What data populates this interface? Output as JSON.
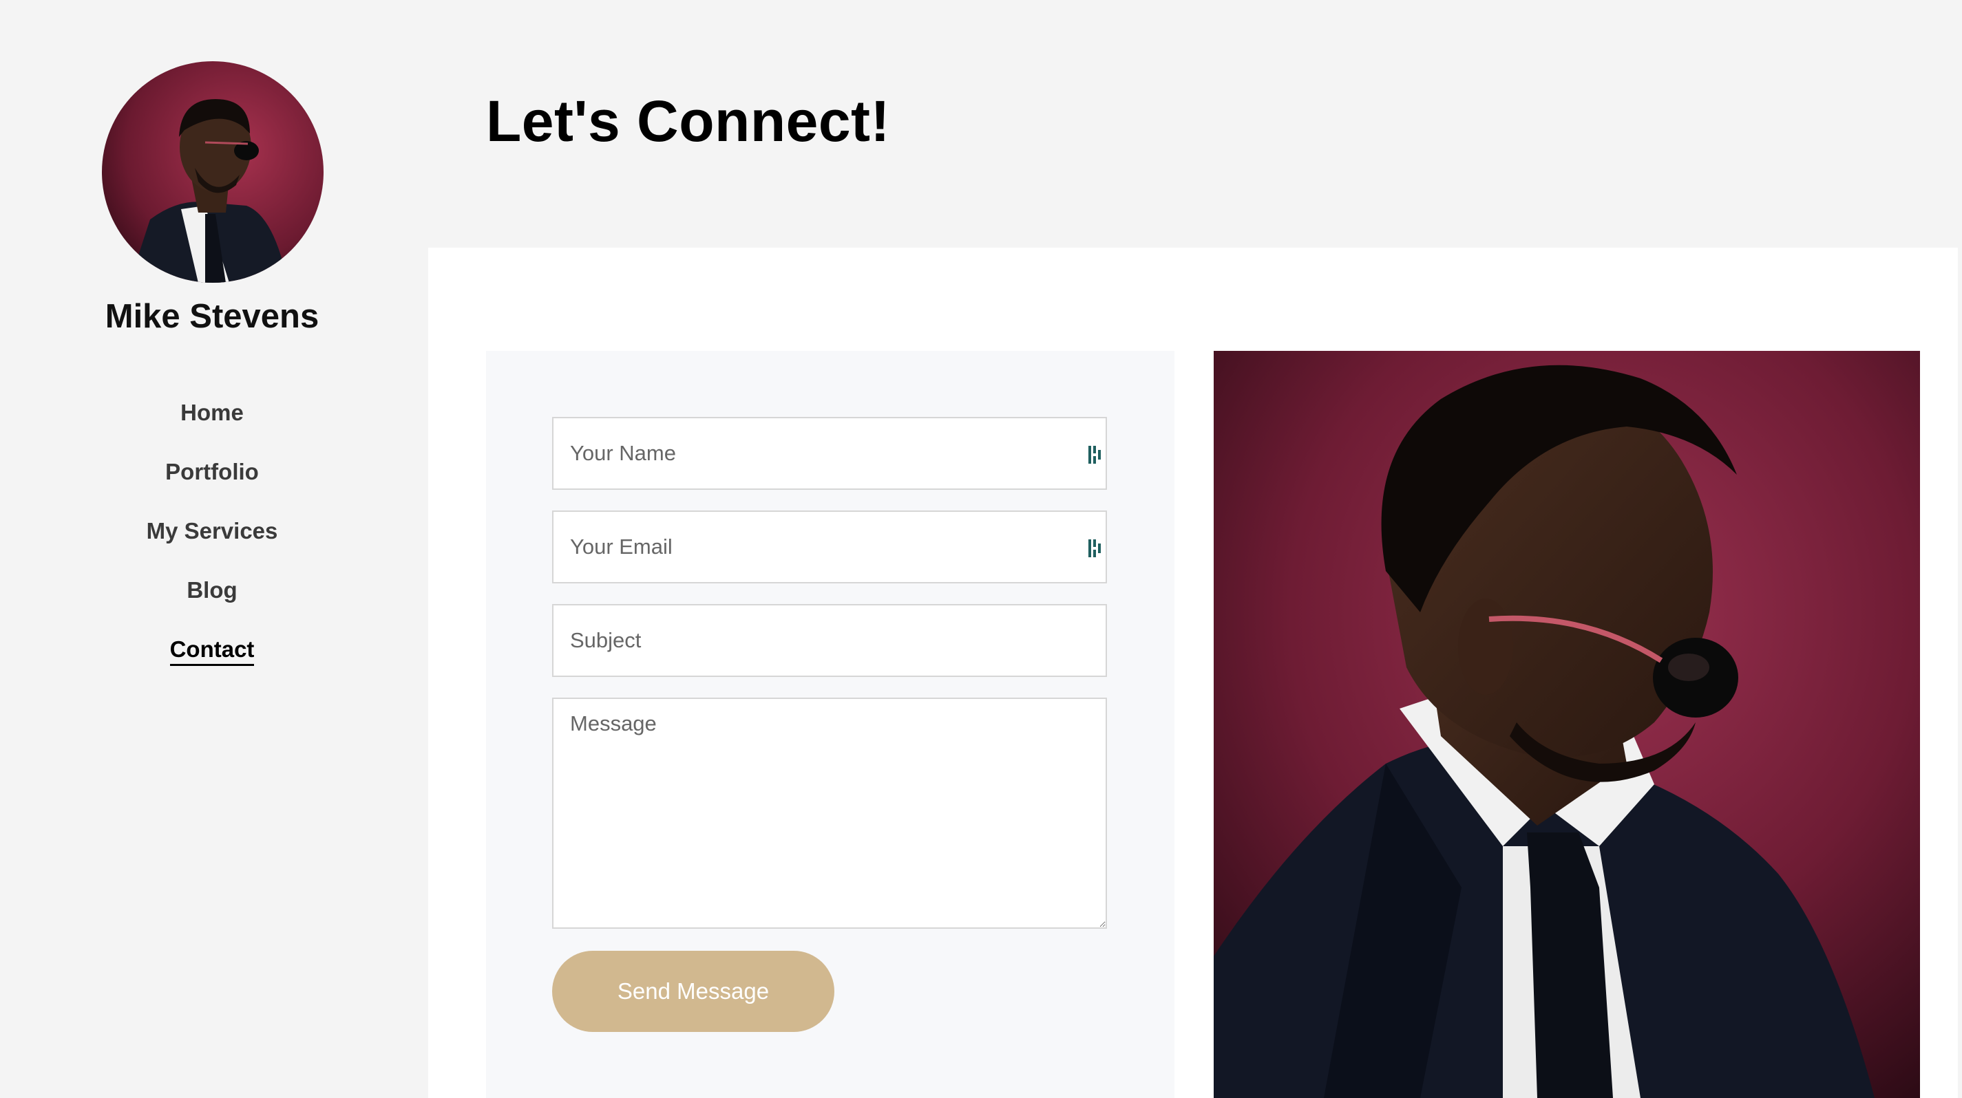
{
  "profile": {
    "name": "Mike Stevens",
    "avatar_alt": "profile-photo"
  },
  "nav": {
    "items": [
      {
        "label": "Home",
        "active": false
      },
      {
        "label": "Portfolio",
        "active": false
      },
      {
        "label": "My Services",
        "active": false
      },
      {
        "label": "Blog",
        "active": false
      },
      {
        "label": "Contact",
        "active": true
      }
    ]
  },
  "page": {
    "title": "Let's Connect!"
  },
  "form": {
    "name_placeholder": "Your Name",
    "email_placeholder": "Your Email",
    "subject_placeholder": "Subject",
    "message_placeholder": "Message",
    "name_value": "",
    "email_value": "",
    "subject_value": "",
    "message_value": "",
    "submit_label": "Send Message",
    "autofill_icon": "password-manager-icon"
  },
  "colors": {
    "button": "#d1b88f",
    "autofill_icon": "#1f5f5f",
    "portrait_backdrop": "#7a1f3a"
  }
}
